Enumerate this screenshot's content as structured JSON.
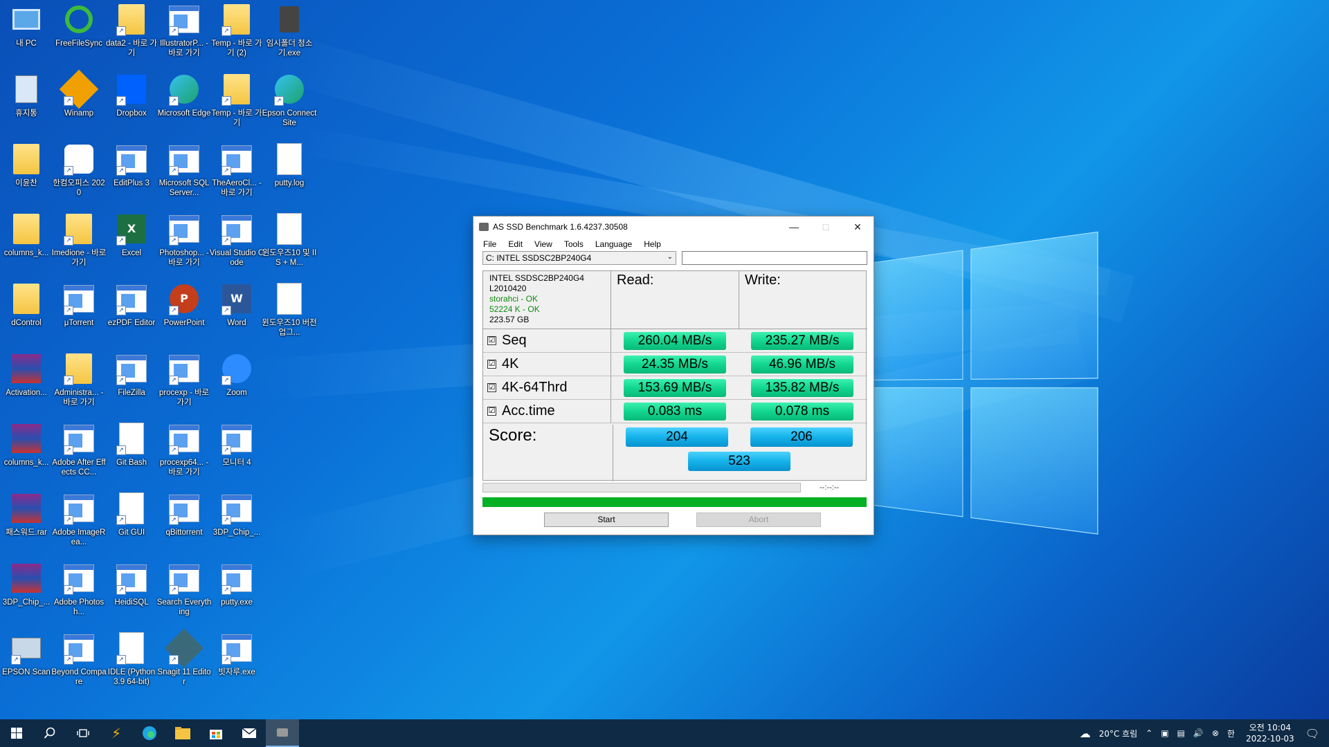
{
  "desktop_icons": [
    {
      "label": "내 PC",
      "kind": "pc",
      "icon": "computer-icon",
      "shortcut": false
    },
    {
      "label": "FreeFileSync",
      "kind": "sync",
      "icon": "sync-icon",
      "shortcut": false
    },
    {
      "label": "data2 - 바로 가기",
      "kind": "folder",
      "icon": "folder-icon",
      "shortcut": true
    },
    {
      "label": "IllustratorP... - 바로 가기",
      "kind": "app",
      "icon": "app-window-icon",
      "shortcut": true
    },
    {
      "label": "Temp - 바로 가기 (2)",
      "kind": "folder",
      "icon": "folder-icon",
      "shortcut": true
    },
    {
      "label": "임시폴더 청소기.exe",
      "kind": "trash",
      "icon": "trash-can-icon",
      "shortcut": false
    },
    {
      "label": "휴지통",
      "kind": "recycle",
      "icon": "recycle-bin-icon",
      "shortcut": false
    },
    {
      "label": "Winamp",
      "kind": "winamp",
      "icon": "winamp-icon",
      "shortcut": true
    },
    {
      "label": "Dropbox",
      "kind": "dropbox",
      "icon": "dropbox-icon",
      "shortcut": true
    },
    {
      "label": "Microsoft Edge",
      "kind": "edge",
      "icon": "edge-icon",
      "shortcut": true
    },
    {
      "label": "Temp - 바로 가기",
      "kind": "folder",
      "icon": "folder-icon",
      "shortcut": true
    },
    {
      "label": "Epson Connect Site",
      "kind": "edge",
      "icon": "edge-icon",
      "shortcut": true
    },
    {
      "label": "이윤찬",
      "kind": "user",
      "icon": "user-folder-icon",
      "shortcut": false
    },
    {
      "label": "한컴오피스 2020",
      "kind": "hancom",
      "icon": "hancom-icon",
      "shortcut": true
    },
    {
      "label": "EditPlus 3",
      "kind": "app",
      "icon": "app-window-icon",
      "shortcut": true
    },
    {
      "label": "Microsoft SQL Server...",
      "kind": "app",
      "icon": "app-window-icon",
      "shortcut": true
    },
    {
      "label": "TheAeroCl... - 바로 가기",
      "kind": "app",
      "icon": "app-window-icon",
      "shortcut": true
    },
    {
      "label": "putty.log",
      "kind": "doc",
      "icon": "text-file-icon",
      "shortcut": false
    },
    {
      "label": "columns_k...",
      "kind": "folder",
      "icon": "folder-icon",
      "shortcut": false
    },
    {
      "label": "Imedione - 바로 가기",
      "kind": "folder",
      "icon": "folder-icon",
      "shortcut": true
    },
    {
      "label": "Excel",
      "kind": "excel",
      "icon": "excel-icon",
      "shortcut": true
    },
    {
      "label": "Photoshop... - 바로 가기",
      "kind": "app",
      "icon": "app-window-icon",
      "shortcut": true
    },
    {
      "label": "Visual Studio Code",
      "kind": "app",
      "icon": "app-window-icon",
      "shortcut": true
    },
    {
      "label": "윈도우즈10 및 IIS + M...",
      "kind": "doc",
      "icon": "document-icon",
      "shortcut": false
    },
    {
      "label": "dControl",
      "kind": "folder",
      "icon": "folder-icon",
      "shortcut": false
    },
    {
      "label": "μTorrent",
      "kind": "app",
      "icon": "app-window-icon",
      "shortcut": true
    },
    {
      "label": "ezPDF Editor",
      "kind": "app",
      "icon": "app-window-icon",
      "shortcut": true
    },
    {
      "label": "PowerPoint",
      "kind": "ppt",
      "icon": "powerpoint-icon",
      "shortcut": true
    },
    {
      "label": "Word",
      "kind": "word",
      "icon": "word-icon",
      "shortcut": true
    },
    {
      "label": "윈도우즈10 버전 업그...",
      "kind": "doc",
      "icon": "document-icon",
      "shortcut": false
    },
    {
      "label": "Activation...",
      "kind": "rar",
      "icon": "winrar-archive-icon",
      "shortcut": false
    },
    {
      "label": "Administra... - 바로 가기",
      "kind": "folder",
      "icon": "folder-icon",
      "shortcut": true
    },
    {
      "label": "FileZilla",
      "kind": "app",
      "icon": "app-window-icon",
      "shortcut": true
    },
    {
      "label": "procexp - 바로 가기",
      "kind": "app",
      "icon": "app-window-icon",
      "shortcut": true
    },
    {
      "label": "Zoom",
      "kind": "zoom",
      "icon": "zoom-icon",
      "shortcut": true
    },
    {
      "label": "",
      "kind": "none",
      "icon": "",
      "shortcut": false
    },
    {
      "label": "columns_k...",
      "kind": "rar",
      "icon": "winrar-archive-icon",
      "shortcut": false
    },
    {
      "label": "Adobe After Effects CC...",
      "kind": "app",
      "icon": "app-window-icon",
      "shortcut": true
    },
    {
      "label": "Git Bash",
      "kind": "doc",
      "icon": "file-icon",
      "shortcut": true
    },
    {
      "label": "procexp64... - 바로 가기",
      "kind": "app",
      "icon": "app-window-icon",
      "shortcut": true
    },
    {
      "label": "모니터 4",
      "kind": "app",
      "icon": "app-window-icon",
      "shortcut": true
    },
    {
      "label": "",
      "kind": "none",
      "icon": "",
      "shortcut": false
    },
    {
      "label": "패스워드.rar",
      "kind": "rar",
      "icon": "winrar-archive-icon",
      "shortcut": false
    },
    {
      "label": "Adobe ImageRea...",
      "kind": "app",
      "icon": "app-window-icon",
      "shortcut": true
    },
    {
      "label": "Git GUI",
      "kind": "doc",
      "icon": "file-icon",
      "shortcut": true
    },
    {
      "label": "qBittorrent",
      "kind": "app",
      "icon": "app-window-icon",
      "shortcut": true
    },
    {
      "label": "3DP_Chip_...",
      "kind": "app",
      "icon": "app-window-icon",
      "shortcut": true
    },
    {
      "label": "",
      "kind": "none",
      "icon": "",
      "shortcut": false
    },
    {
      "label": "3DP_Chip_...",
      "kind": "rar",
      "icon": "winrar-archive-icon",
      "shortcut": false
    },
    {
      "label": "Adobe Photosh...",
      "kind": "app",
      "icon": "app-window-icon",
      "shortcut": true
    },
    {
      "label": "HeidiSQL",
      "kind": "app",
      "icon": "app-window-icon",
      "shortcut": true
    },
    {
      "label": "Search Everything",
      "kind": "app",
      "icon": "app-window-icon",
      "shortcut": true
    },
    {
      "label": "putty.exe",
      "kind": "app",
      "icon": "app-window-icon",
      "shortcut": true
    },
    {
      "label": "",
      "kind": "none",
      "icon": "",
      "shortcut": false
    },
    {
      "label": "EPSON Scan",
      "kind": "scan",
      "icon": "scanner-icon",
      "shortcut": true
    },
    {
      "label": "Beyond Compare",
      "kind": "app",
      "icon": "app-window-icon",
      "shortcut": true
    },
    {
      "label": "IDLE (Python 3.9 64-bit)",
      "kind": "doc",
      "icon": "file-icon",
      "shortcut": true
    },
    {
      "label": "Snagit 11 Editor",
      "kind": "snagit",
      "icon": "snagit-icon",
      "shortcut": true
    },
    {
      "label": "빗자루.exe",
      "kind": "app",
      "icon": "app-window-icon",
      "shortcut": true
    }
  ],
  "window": {
    "title": "AS SSD Benchmark 1.6.4237.30508",
    "menu": [
      "File",
      "Edit",
      "View",
      "Tools",
      "Language",
      "Help"
    ],
    "drive_select": "C: INTEL SSDSC2BP240G4",
    "drive_info": {
      "model": "INTEL SSDSC2BP240G4",
      "firmware": "L2010420",
      "driver": "storahci - OK",
      "alignment": "52224 K - OK",
      "size": "223.57 GB"
    },
    "read_header": "Read:",
    "write_header": "Write:",
    "tests": [
      {
        "name": "Seq",
        "checked": "☑",
        "read": "260.04 MB/s",
        "write": "235.27 MB/s"
      },
      {
        "name": "4K",
        "checked": "☑",
        "read": "24.35 MB/s",
        "write": "46.96 MB/s"
      },
      {
        "name": "4K-64Thrd",
        "checked": "☑",
        "read": "153.69 MB/s",
        "write": "135.82 MB/s"
      },
      {
        "name": "Acc.time",
        "checked": "☑",
        "read": "0.083 ms",
        "write": "0.078 ms"
      }
    ],
    "score_label": "Score:",
    "score_read": "204",
    "score_write": "206",
    "score_total": "523",
    "time_display": "--:--:--",
    "start_label": "Start",
    "abort_label": "Abort"
  },
  "taskbar": {
    "weather": "20°C 흐림",
    "time": "오전 10:04",
    "date": "2022-10-03",
    "ime": "한"
  }
}
